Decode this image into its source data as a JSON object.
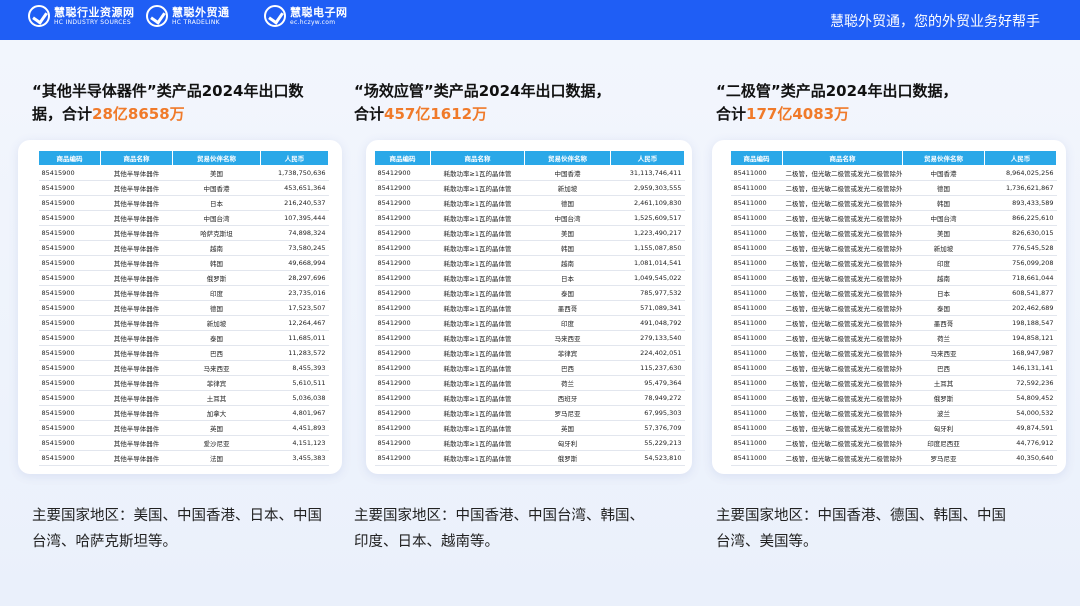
{
  "header": {
    "logos": [
      {
        "cn": "慧聪行业资源网",
        "en": "HC INDUSTRY SOURCES"
      },
      {
        "cn": "慧聪外贸通",
        "en": "HC TRADELINK"
      },
      {
        "cn": "慧聪电子网",
        "en": "ec.hczyw.com"
      }
    ],
    "slogan": "慧聪外贸通，您的外贸业务好帮手"
  },
  "panels": [
    {
      "title_a": "“其他半导体器件”类产品2024年出口数",
      "title_b": "据，合计",
      "total": "28亿8658万",
      "columns": [
        "商品编码",
        "商品名称",
        "贸易伙伴名称",
        "人民币"
      ],
      "rows": [
        [
          "85415900",
          "其他半导体器件",
          "美国",
          "1,738,750,636"
        ],
        [
          "85415900",
          "其他半导体器件",
          "中国香港",
          "453,651,364"
        ],
        [
          "85415900",
          "其他半导体器件",
          "日本",
          "216,240,537"
        ],
        [
          "85415900",
          "其他半导体器件",
          "中国台湾",
          "107,395,444"
        ],
        [
          "85415900",
          "其他半导体器件",
          "哈萨克斯坦",
          "74,898,324"
        ],
        [
          "85415900",
          "其他半导体器件",
          "越南",
          "73,580,245"
        ],
        [
          "85415900",
          "其他半导体器件",
          "韩国",
          "49,668,994"
        ],
        [
          "85415900",
          "其他半导体器件",
          "俄罗斯",
          "28,297,696"
        ],
        [
          "85415900",
          "其他半导体器件",
          "印度",
          "23,735,016"
        ],
        [
          "85415900",
          "其他半导体器件",
          "德国",
          "17,523,507"
        ],
        [
          "85415900",
          "其他半导体器件",
          "新加坡",
          "12,264,467"
        ],
        [
          "85415900",
          "其他半导体器件",
          "泰国",
          "11,685,011"
        ],
        [
          "85415900",
          "其他半导体器件",
          "巴西",
          "11,283,572"
        ],
        [
          "85415900",
          "其他半导体器件",
          "马来西亚",
          "8,455,393"
        ],
        [
          "85415900",
          "其他半导体器件",
          "菲律宾",
          "5,610,511"
        ],
        [
          "85415900",
          "其他半导体器件",
          "土耳其",
          "5,036,038"
        ],
        [
          "85415900",
          "其他半导体器件",
          "加拿大",
          "4,801,967"
        ],
        [
          "85415900",
          "其他半导体器件",
          "英国",
          "4,451,893"
        ],
        [
          "85415900",
          "其他半导体器件",
          "爱沙尼亚",
          "4,151,123"
        ],
        [
          "85415900",
          "其他半导体器件",
          "法国",
          "3,455,383"
        ]
      ],
      "summary": "主要国家地区：美国、中国香港、日本、中国台湾、哈萨克斯坦等。"
    },
    {
      "title_a": "“场效应管”类产品2024年出口数据，",
      "title_b": "合计",
      "total": "457亿1612万",
      "columns": [
        "商品编码",
        "商品名称",
        "贸易伙伴名称",
        "人民币"
      ],
      "rows": [
        [
          "85412900",
          "耗散功率≥1瓦的晶体管",
          "中国香港",
          "31,113,746,411"
        ],
        [
          "85412900",
          "耗散功率≥1瓦的晶体管",
          "新加坡",
          "2,959,303,555"
        ],
        [
          "85412900",
          "耗散功率≥1瓦的晶体管",
          "德国",
          "2,461,109,830"
        ],
        [
          "85412900",
          "耗散功率≥1瓦的晶体管",
          "中国台湾",
          "1,525,609,517"
        ],
        [
          "85412900",
          "耗散功率≥1瓦的晶体管",
          "美国",
          "1,223,490,217"
        ],
        [
          "85412900",
          "耗散功率≥1瓦的晶体管",
          "韩国",
          "1,155,087,850"
        ],
        [
          "85412900",
          "耗散功率≥1瓦的晶体管",
          "越南",
          "1,081,014,541"
        ],
        [
          "85412900",
          "耗散功率≥1瓦的晶体管",
          "日本",
          "1,049,545,022"
        ],
        [
          "85412900",
          "耗散功率≥1瓦的晶体管",
          "泰国",
          "785,977,532"
        ],
        [
          "85412900",
          "耗散功率≥1瓦的晶体管",
          "墨西哥",
          "571,089,341"
        ],
        [
          "85412900",
          "耗散功率≥1瓦的晶体管",
          "印度",
          "491,048,792"
        ],
        [
          "85412900",
          "耗散功率≥1瓦的晶体管",
          "马来西亚",
          "279,133,540"
        ],
        [
          "85412900",
          "耗散功率≥1瓦的晶体管",
          "菲律宾",
          "224,402,051"
        ],
        [
          "85412900",
          "耗散功率≥1瓦的晶体管",
          "巴西",
          "115,237,630"
        ],
        [
          "85412900",
          "耗散功率≥1瓦的晶体管",
          "荷兰",
          "95,479,364"
        ],
        [
          "85412900",
          "耗散功率≥1瓦的晶体管",
          "西班牙",
          "78,949,272"
        ],
        [
          "85412900",
          "耗散功率≥1瓦的晶体管",
          "罗马尼亚",
          "67,995,303"
        ],
        [
          "85412900",
          "耗散功率≥1瓦的晶体管",
          "英国",
          "57,376,709"
        ],
        [
          "85412900",
          "耗散功率≥1瓦的晶体管",
          "匈牙利",
          "55,229,213"
        ],
        [
          "85412900",
          "耗散功率≥1瓦的晶体管",
          "俄罗斯",
          "54,523,810"
        ]
      ],
      "summary": "主要国家地区：中国香港、中国台湾、韩国、印度、日本、越南等。"
    },
    {
      "title_a": "“二极管”类产品2024年出口数据，",
      "title_b": "合计",
      "total": "177亿4083万",
      "columns": [
        "商品编码",
        "商品名称",
        "贸易伙伴名称",
        "人民币"
      ],
      "rows": [
        [
          "85411000",
          "二极管，但光敏二极管或发光二极管除外",
          "中国香港",
          "8,964,025,256"
        ],
        [
          "85411000",
          "二极管，但光敏二极管或发光二极管除外",
          "德国",
          "1,736,621,867"
        ],
        [
          "85411000",
          "二极管，但光敏二极管或发光二极管除外",
          "韩国",
          "893,433,589"
        ],
        [
          "85411000",
          "二极管，但光敏二极管或发光二极管除外",
          "中国台湾",
          "866,225,610"
        ],
        [
          "85411000",
          "二极管，但光敏二极管或发光二极管除外",
          "美国",
          "826,630,015"
        ],
        [
          "85411000",
          "二极管，但光敏二极管或发光二极管除外",
          "新加坡",
          "776,545,528"
        ],
        [
          "85411000",
          "二极管，但光敏二极管或发光二极管除外",
          "印度",
          "756,099,208"
        ],
        [
          "85411000",
          "二极管，但光敏二极管或发光二极管除外",
          "越南",
          "718,661,044"
        ],
        [
          "85411000",
          "二极管，但光敏二极管或发光二极管除外",
          "日本",
          "608,541,877"
        ],
        [
          "85411000",
          "二极管，但光敏二极管或发光二极管除外",
          "泰国",
          "202,462,689"
        ],
        [
          "85411000",
          "二极管，但光敏二极管或发光二极管除外",
          "墨西哥",
          "198,188,547"
        ],
        [
          "85411000",
          "二极管，但光敏二极管或发光二极管除外",
          "荷兰",
          "194,858,121"
        ],
        [
          "85411000",
          "二极管，但光敏二极管或发光二极管除外",
          "马来西亚",
          "168,947,987"
        ],
        [
          "85411000",
          "二极管，但光敏二极管或发光二极管除外",
          "巴西",
          "146,131,141"
        ],
        [
          "85411000",
          "二极管，但光敏二极管或发光二极管除外",
          "土耳其",
          "72,592,236"
        ],
        [
          "85411000",
          "二极管，但光敏二极管或发光二极管除外",
          "俄罗斯",
          "54,809,452"
        ],
        [
          "85411000",
          "二极管，但光敏二极管或发光二极管除外",
          "波兰",
          "54,000,532"
        ],
        [
          "85411000",
          "二极管，但光敏二极管或发光二极管除外",
          "匈牙利",
          "49,874,591"
        ],
        [
          "85411000",
          "二极管，但光敏二极管或发光二极管除外",
          "印度尼西亚",
          "44,776,912"
        ],
        [
          "85411000",
          "二极管，但光敏二极管或发光二极管除外",
          "罗马尼亚",
          "40,350,640"
        ]
      ],
      "summary": "主要国家地区：中国香港、德国、韩国、中国台湾、美国等。"
    }
  ]
}
